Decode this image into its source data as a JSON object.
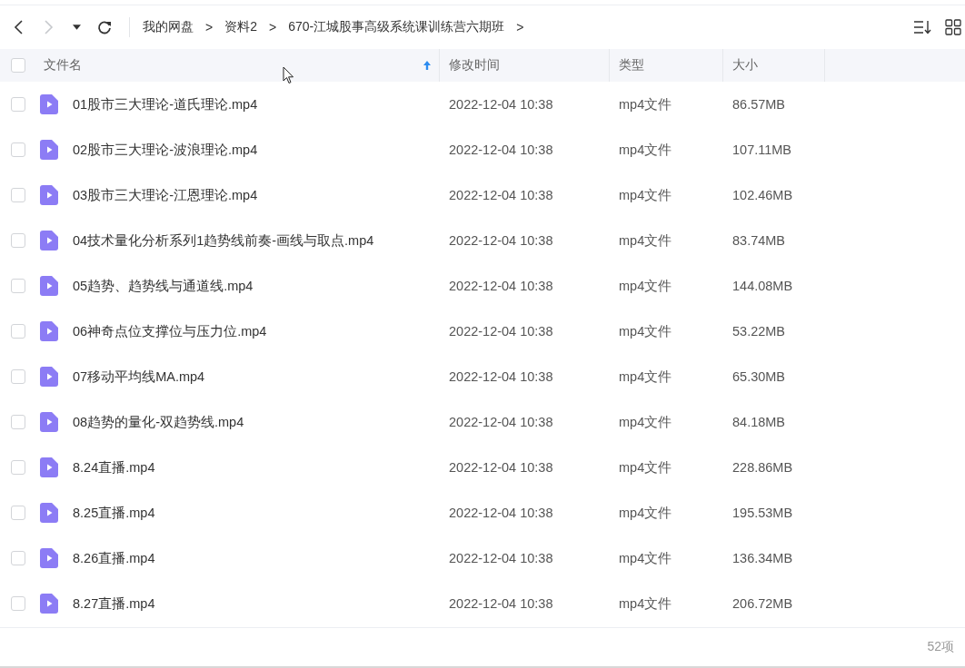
{
  "toolbar": {
    "nav": [
      {
        "kind": "back",
        "disabled": false
      },
      {
        "kind": "forward",
        "disabled": true
      },
      {
        "kind": "dropdown",
        "disabled": false
      },
      {
        "kind": "refresh",
        "disabled": false
      }
    ],
    "breadcrumbs": [
      {
        "label": "我的网盘",
        "separator": ">"
      },
      {
        "label": "资料2",
        "separator": ">"
      },
      {
        "label": "670-江城股事高级系统课训练营六期班",
        "separator": ">"
      }
    ]
  },
  "table": {
    "select_all": {
      "checked": false
    },
    "columns": [
      {
        "label": "文件名",
        "sorted": true
      },
      {
        "label": "修改时间",
        "sorted": false
      },
      {
        "label": "类型",
        "sorted": false
      },
      {
        "label": "大小",
        "sorted": false
      }
    ],
    "rows": [
      {
        "checked": false,
        "name": "01股市三大理论-道氏理论.mp4",
        "modified": "2022-12-04 10:38",
        "type": "mp4文件",
        "size": "86.57MB"
      },
      {
        "checked": false,
        "name": "02股市三大理论-波浪理论.mp4",
        "modified": "2022-12-04 10:38",
        "type": "mp4文件",
        "size": "107.11MB"
      },
      {
        "checked": false,
        "name": "03股市三大理论-江恩理论.mp4",
        "modified": "2022-12-04 10:38",
        "type": "mp4文件",
        "size": "102.46MB"
      },
      {
        "checked": false,
        "name": "04技术量化分析系列1趋势线前奏-画线与取点.mp4",
        "modified": "2022-12-04 10:38",
        "type": "mp4文件",
        "size": "83.74MB"
      },
      {
        "checked": false,
        "name": "05趋势、趋势线与通道线.mp4",
        "modified": "2022-12-04 10:38",
        "type": "mp4文件",
        "size": "144.08MB"
      },
      {
        "checked": false,
        "name": "06神奇点位支撑位与压力位.mp4",
        "modified": "2022-12-04 10:38",
        "type": "mp4文件",
        "size": "53.22MB"
      },
      {
        "checked": false,
        "name": "07移动平均线MA.mp4",
        "modified": "2022-12-04 10:38",
        "type": "mp4文件",
        "size": "65.30MB"
      },
      {
        "checked": false,
        "name": "08趋势的量化-双趋势线.mp4",
        "modified": "2022-12-04 10:38",
        "type": "mp4文件",
        "size": "84.18MB"
      },
      {
        "checked": false,
        "name": "8.24直播.mp4",
        "modified": "2022-12-04 10:38",
        "type": "mp4文件",
        "size": "228.86MB"
      },
      {
        "checked": false,
        "name": "8.25直播.mp4",
        "modified": "2022-12-04 10:38",
        "type": "mp4文件",
        "size": "195.53MB"
      },
      {
        "checked": false,
        "name": "8.26直播.mp4",
        "modified": "2022-12-04 10:38",
        "type": "mp4文件",
        "size": "136.34MB"
      },
      {
        "checked": false,
        "name": "8.27直播.mp4",
        "modified": "2022-12-04 10:38",
        "type": "mp4文件",
        "size": "206.72MB"
      }
    ]
  },
  "status_bar": {
    "count": "52项"
  }
}
